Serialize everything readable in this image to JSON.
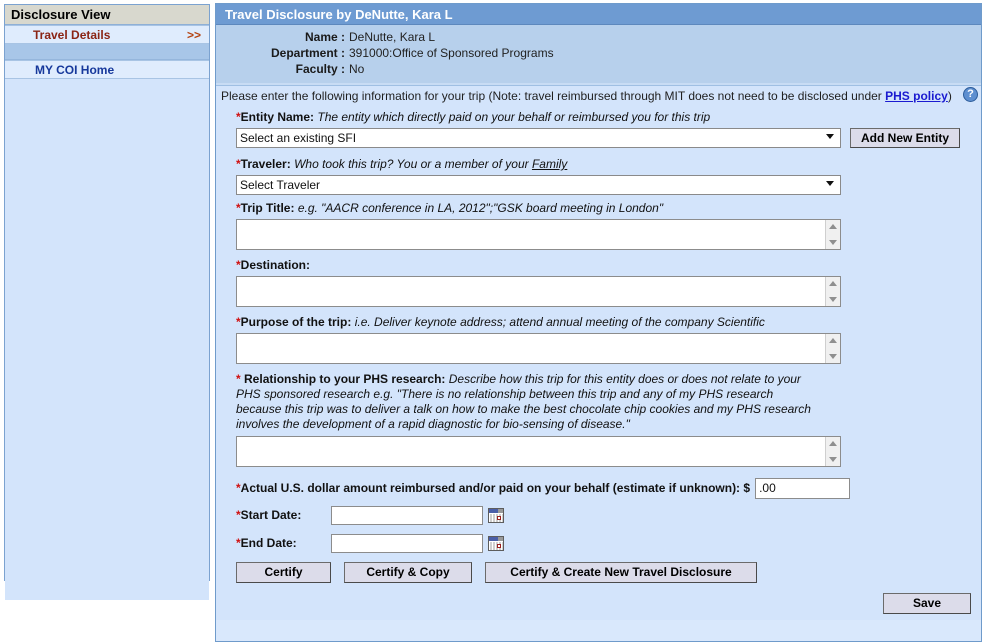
{
  "sidebar": {
    "header": "Disclosure View",
    "items": [
      {
        "label": "Travel Details",
        "chevron": ">>",
        "active": true
      },
      {
        "label": "MY COI Home",
        "active": false
      }
    ]
  },
  "panel": {
    "title": "Travel Disclosure by DeNutte, Kara L",
    "meta": [
      {
        "label": "Name :",
        "value": "DeNutte, Kara L"
      },
      {
        "label": "Department :",
        "value": "391000:Office of Sponsored Programs"
      },
      {
        "label": "Faculty :",
        "value": "No"
      }
    ],
    "instruction": {
      "text_before": "Please enter the following information for your trip (Note: travel reimbursed through MIT does not need to be disclosed under ",
      "link_text": "PHS policy",
      "text_after": ")",
      "help_icon": "question-mark-icon",
      "help_glyph": "?"
    }
  },
  "form": {
    "entity_name": {
      "marker": "*",
      "label": "Entity Name:",
      "hint": "The entity which directly paid on your behalf or reimbursed you for this trip",
      "selected_option": "Select an existing SFI",
      "options": [
        "Select an existing SFI"
      ],
      "add_button": "Add New Entity"
    },
    "traveler": {
      "marker": "*",
      "label": "Traveler:",
      "hint_before": "Who took this trip? You or a member of your ",
      "hint_link": "Family",
      "selected_option": "Select Traveler",
      "options": [
        "Select Traveler"
      ]
    },
    "trip_title": {
      "marker": "*",
      "label": "Trip Title:",
      "hint": "e.g. \"AACR conference in LA, 2012\";\"GSK board meeting in London\"",
      "value": ""
    },
    "destination": {
      "marker": "*",
      "label": "Destination:",
      "hint": "",
      "value": ""
    },
    "purpose": {
      "marker": "*",
      "label": "Purpose of the trip:",
      "hint": "i.e. Deliver keynote address; attend annual meeting of the company Scientific",
      "value": ""
    },
    "relationship": {
      "marker": "*",
      "label": "Relationship to your PHS research:",
      "hint": "Describe how this trip for this entity does or does not relate to your PHS sponsored research e.g. \"There is no relationship between this trip and any of my PHS research because this trip was to deliver a talk on how to make the best chocolate chip cookies and my PHS research involves the development of a rapid diagnostic for bio-sensing of disease.\"",
      "value": ""
    },
    "amount": {
      "marker": "*",
      "label": "Actual U.S. dollar amount reimbursed and/or paid on your behalf (estimate if unknown): $",
      "value": ".00"
    },
    "start_date": {
      "marker": "*",
      "label": "Start Date:",
      "value": "",
      "calendar_icon": "calendar-icon"
    },
    "end_date": {
      "marker": "*",
      "label": "End Date:",
      "value": "",
      "calendar_icon": "calendar-icon"
    }
  },
  "buttons": {
    "certify": "Certify",
    "certify_copy": "Certify & Copy",
    "certify_create": "Certify & Create  New Travel Disclosure",
    "save": "Save"
  },
  "colors": {
    "panel_header": "#6e9bd2",
    "meta_bg": "#b7d0ec",
    "form_bg": "#d3e4fb",
    "required": "#d01010",
    "link": "#1a1ad0",
    "active_item": "#8a2414",
    "home_item": "#16389b"
  }
}
